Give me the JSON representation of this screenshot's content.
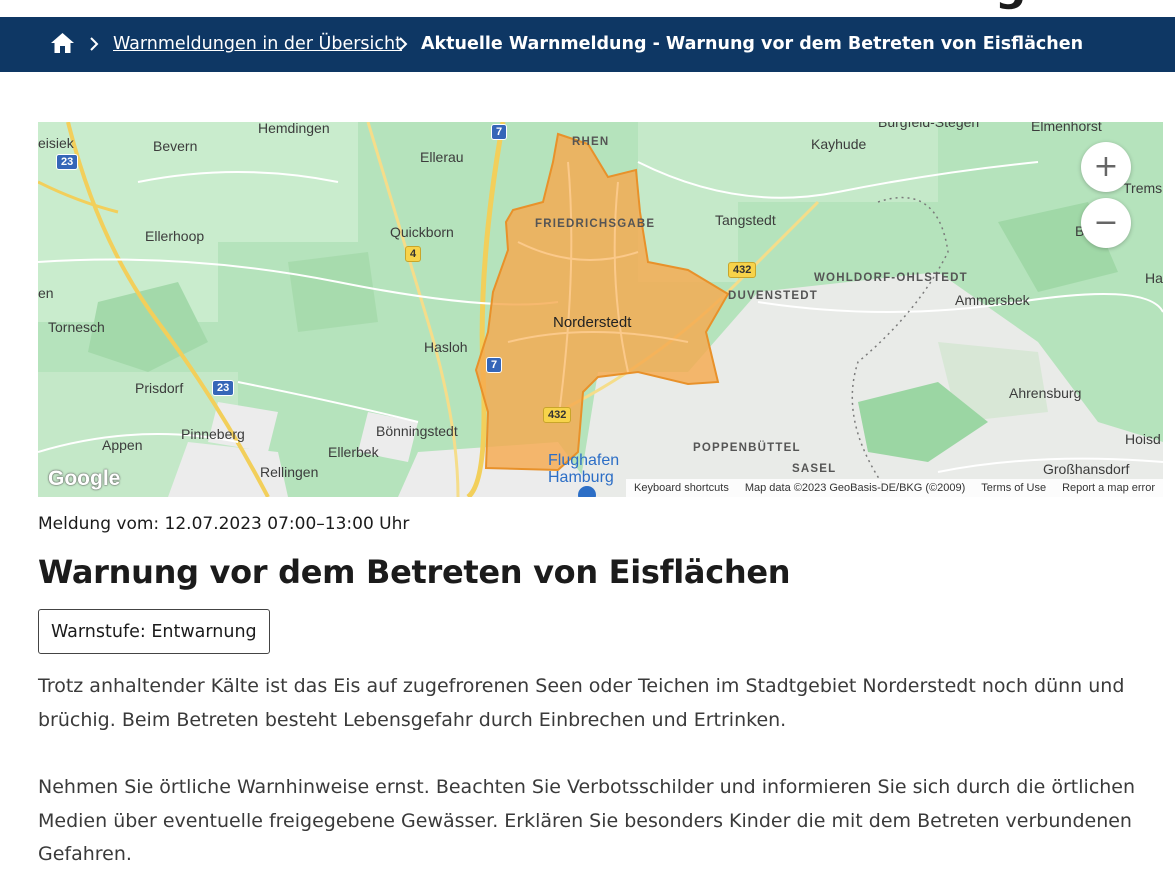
{
  "breadcrumb": {
    "link_label": "Warnmeldungen in der Übersicht",
    "current_label": "Aktuelle Warnmeldung - Warnung vor dem Betreten von Eisflächen"
  },
  "map": {
    "labels": {
      "hemdingen": "Hemdingen",
      "bevern": "Bevern",
      "ellerau": "Ellerau",
      "rhen": "RHEN",
      "kayhude": "Kayhude",
      "burgwedel": "Burgfeld-Stegen",
      "elmenhorst": "Elmenhorst",
      "ellerhoop": "Ellerhoop",
      "quickborn": "Quickborn",
      "friedrichsgabe": "FRIEDRICHSGABE",
      "tangstedt": "Tangstedt",
      "bargteheide": "Bargtel",
      "wohldorf": "WOHLDORF-OHLSTEDT",
      "duvenstedt": "DUVENSTEDT",
      "ammersbek": "Ammersbek",
      "tornesch": "Tornesch",
      "norderstedt": "Norderstedt",
      "hasloh": "Hasloh",
      "prisdorf": "Prisdorf",
      "ahrensburg": "Ahrensburg",
      "appen": "Appen",
      "pinneberg": "Pinneberg",
      "boenningstedt": "Bönningstedt",
      "ellerbek": "Ellerbek",
      "poppenbuettel": "POPPENBÜTTEL",
      "hoisdorf": "Hoisd",
      "rellingen": "Rellingen",
      "flughafen": "Flughafen Hamburg",
      "sasel": "SASEL",
      "grosshansdorf": "Großhansdorf",
      "eisiek": "eisiek",
      "tremsb": "Tremsb",
      "ha": "Ha",
      "en": "en"
    },
    "shields": {
      "a23_top": "23",
      "a7_top": "7",
      "b4": "4",
      "a7_mid": "7",
      "a23_mid": "23",
      "b432_top": "432",
      "b432_bottom": "432"
    },
    "attribution": {
      "keyboard": "Keyboard shortcuts",
      "data": "Map data ©2023 GeoBasis-DE/BKG (©2009)",
      "terms": "Terms of Use",
      "report": "Report a map error"
    },
    "logo": "Google",
    "zoom_in": "+",
    "zoom_out": "−",
    "colors": {
      "area_fill": "#f5a94f",
      "area_stroke": "#e8912a",
      "land": "#aadfb1",
      "urban": "#ececec"
    }
  },
  "meta": {
    "date_label": "Meldung vom: 12.07.2023 07:00–13:00 Uhr"
  },
  "title": "Warnung vor dem Betreten von Eisflächen",
  "level": {
    "label": "Warnstufe: Entwarnung"
  },
  "body": {
    "paragraph1": "Trotz anhaltender Kälte ist das Eis auf zugefrorenen Seen oder Teichen im Stadtgebiet Norderstedt noch dünn und brüchig. Beim Betreten besteht Lebensgefahr durch Einbrechen und Ertrinken.",
    "paragraph2": "Nehmen Sie örtliche Warnhinweise ernst. Beachten Sie Verbotsschilder und informieren Sie sich durch die örtlichen Medien über eventuelle freigegebene Gewässer. Erklären Sie besonders Kinder die mit dem Betreten verbundenen Gefahren."
  }
}
